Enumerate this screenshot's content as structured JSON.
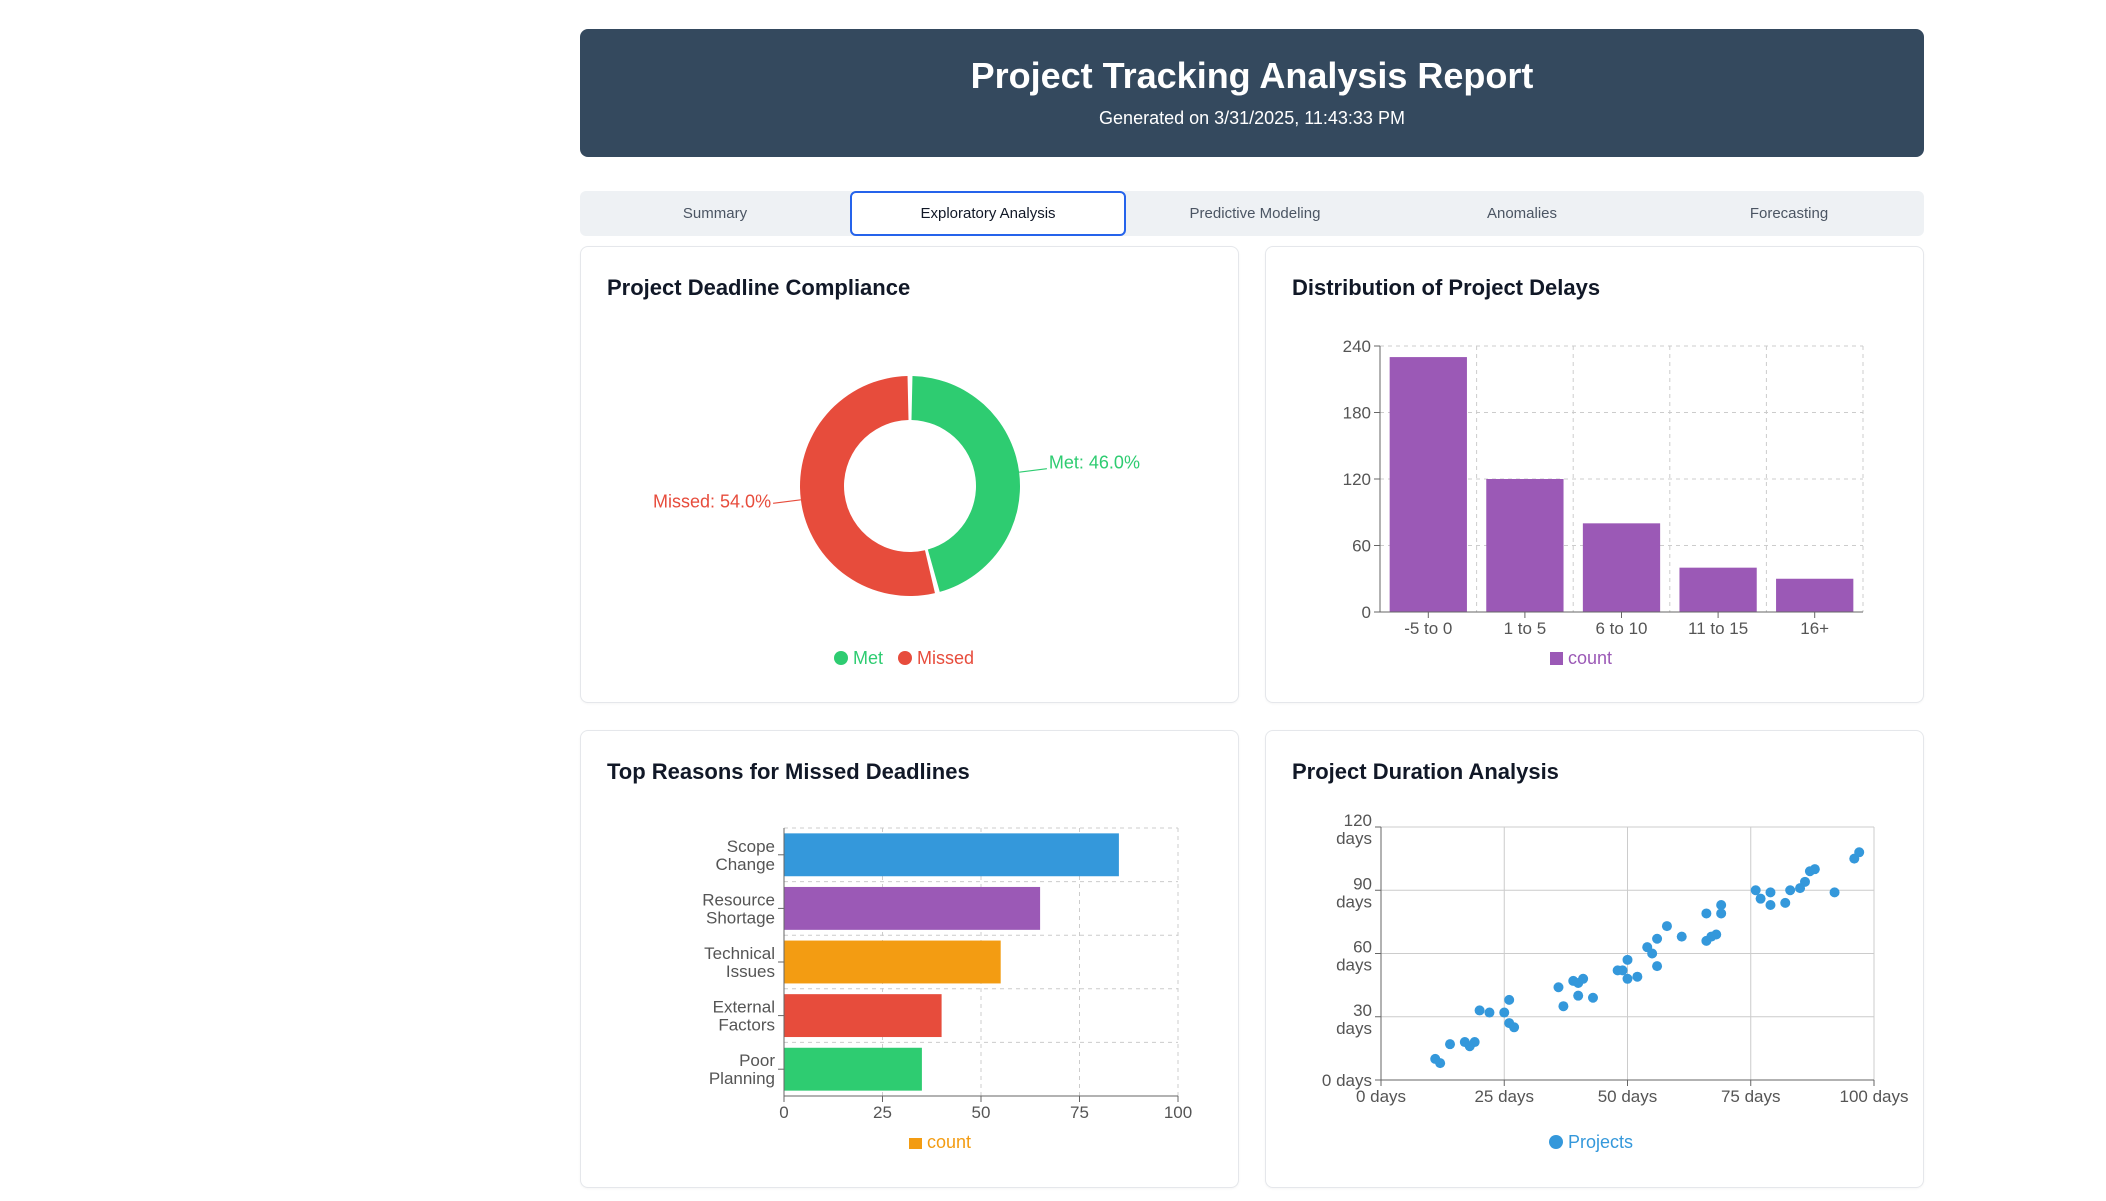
{
  "header": {
    "title": "Project Tracking Analysis Report",
    "generated": "Generated on 3/31/2025, 11:43:33 PM"
  },
  "tabs": [
    {
      "label": "Summary",
      "active": false
    },
    {
      "label": "Exploratory Analysis",
      "active": true
    },
    {
      "label": "Predictive Modeling",
      "active": false
    },
    {
      "label": "Anomalies",
      "active": false
    },
    {
      "label": "Forecasting",
      "active": false
    }
  ],
  "colors": {
    "header_bg": "#34495e",
    "accent": "#2563eb",
    "met": "#2ecc71",
    "missed": "#e74c3c",
    "purple": "#9b59b6",
    "blue": "#3498db",
    "orange": "#f39c12"
  },
  "cards": {
    "compliance_title": "Project Deadline Compliance",
    "delays_title": "Distribution of Project Delays",
    "reasons_title": "Top Reasons for Missed Deadlines",
    "duration_title": "Project Duration Analysis"
  },
  "chart_data": [
    {
      "id": "compliance",
      "type": "pie",
      "slices": [
        {
          "name": "Met",
          "value": 46.0,
          "label": "Met: 46.0%",
          "color": "#2ecc71"
        },
        {
          "name": "Missed",
          "value": 54.0,
          "label": "Missed: 54.0%",
          "color": "#e74c3c"
        }
      ],
      "legend": [
        "Met",
        "Missed"
      ],
      "legend_position": "bottom"
    },
    {
      "id": "delays",
      "type": "bar",
      "categories": [
        "-5 to 0",
        "1 to 5",
        "6 to 10",
        "11 to 15",
        "16+"
      ],
      "series": [
        {
          "name": "count",
          "values": [
            230,
            120,
            80,
            40,
            30
          ],
          "color": "#9b59b6"
        }
      ],
      "yticks": [
        "0",
        "60",
        "120",
        "180",
        "240"
      ],
      "ylim": [
        0,
        240
      ],
      "grid": true,
      "legend_position": "bottom"
    },
    {
      "id": "reasons",
      "type": "bar",
      "orientation": "horizontal",
      "categories": [
        [
          "Scope",
          "Change"
        ],
        [
          "Resource",
          "Shortage"
        ],
        [
          "Technical",
          "Issues"
        ],
        [
          "External",
          "Factors"
        ],
        [
          "Poor",
          "Planning"
        ]
      ],
      "series": [
        {
          "name": "count",
          "values": [
            85,
            65,
            55,
            40,
            35
          ]
        }
      ],
      "bar_colors": [
        "#3498db",
        "#9b59b6",
        "#f39c12",
        "#e74c3c",
        "#2ecc71"
      ],
      "xticks": [
        "0",
        "25",
        "50",
        "75",
        "100"
      ],
      "xlim": [
        0,
        100
      ],
      "grid": true,
      "legend_color": "#f39c12",
      "legend_position": "bottom"
    },
    {
      "id": "duration",
      "type": "scatter",
      "series": [
        {
          "name": "Projects",
          "color": "#3498db",
          "points": [
            [
              11,
              10
            ],
            [
              12,
              8
            ],
            [
              14,
              17
            ],
            [
              17,
              18
            ],
            [
              18,
              16
            ],
            [
              19,
              18
            ],
            [
              20,
              33
            ],
            [
              22,
              32
            ],
            [
              25,
              32
            ],
            [
              26,
              38
            ],
            [
              26,
              27
            ],
            [
              27,
              25
            ],
            [
              36,
              44
            ],
            [
              37,
              35
            ],
            [
              39,
              47
            ],
            [
              40,
              46
            ],
            [
              40,
              40
            ],
            [
              41,
              48
            ],
            [
              43,
              39
            ],
            [
              48,
              52
            ],
            [
              49,
              52
            ],
            [
              50,
              48
            ],
            [
              50,
              57
            ],
            [
              52,
              49
            ],
            [
              54,
              63
            ],
            [
              55,
              60
            ],
            [
              56,
              67
            ],
            [
              56,
              54
            ],
            [
              58,
              73
            ],
            [
              61,
              68
            ],
            [
              66,
              79
            ],
            [
              66,
              66
            ],
            [
              67,
              68
            ],
            [
              68,
              69
            ],
            [
              69,
              79
            ],
            [
              69,
              83
            ],
            [
              76,
              90
            ],
            [
              77,
              86
            ],
            [
              79,
              89
            ],
            [
              79,
              83
            ],
            [
              82,
              84
            ],
            [
              83,
              90
            ],
            [
              85,
              91
            ],
            [
              86,
              94
            ],
            [
              87,
              99
            ],
            [
              88,
              100
            ],
            [
              92,
              89
            ],
            [
              96,
              105
            ],
            [
              97,
              108
            ]
          ]
        }
      ],
      "xticks": [
        "0 days",
        "25 days",
        "50 days",
        "75 days",
        "100 days"
      ],
      "yticks": [
        [
          "0 days"
        ],
        [
          "30",
          "days"
        ],
        [
          "60",
          "days"
        ],
        [
          "90",
          "days"
        ],
        [
          "120",
          "days"
        ]
      ],
      "xlim": [
        0,
        100
      ],
      "ylim": [
        0,
        120
      ],
      "grid": true,
      "legend_position": "bottom"
    }
  ]
}
